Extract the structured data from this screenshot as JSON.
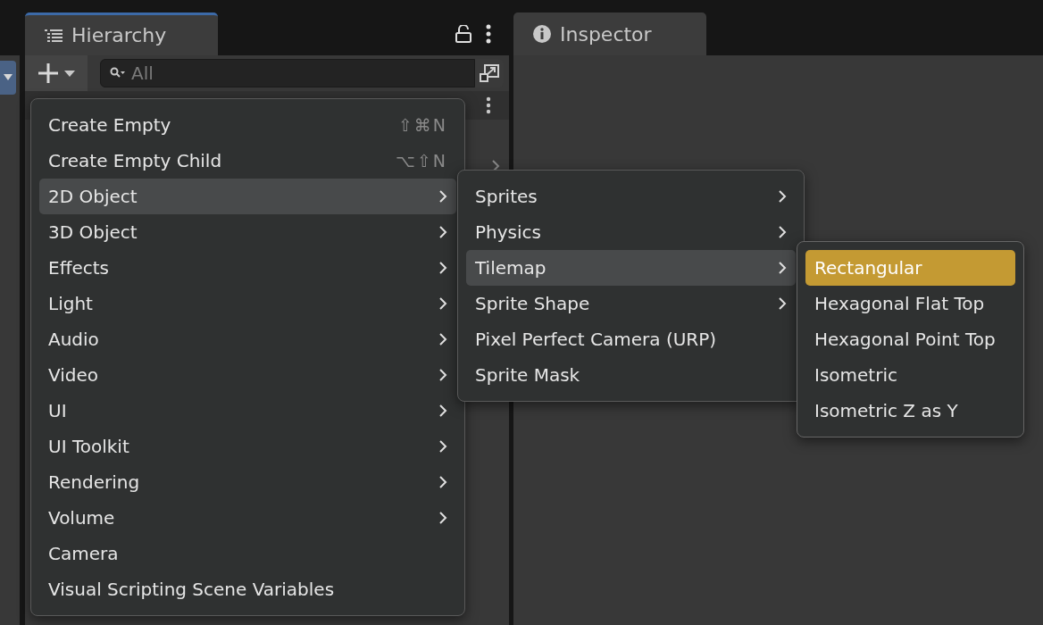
{
  "hierarchy": {
    "tab": {
      "label": "Hierarchy",
      "selected": true
    },
    "search": {
      "placeholder": "All"
    }
  },
  "inspector": {
    "tab": {
      "label": "Inspector",
      "selected": false
    }
  },
  "menus": [
    {
      "focused": false,
      "items": [
        {
          "label": "Create Empty",
          "kind": "action",
          "shortcut": "⇧⌘N",
          "selected": false
        },
        {
          "label": "Create Empty Child",
          "kind": "action",
          "shortcut": "⌥⇧N",
          "selected": false
        },
        {
          "label": "2D Object",
          "kind": "submenu",
          "selected": true
        },
        {
          "label": "3D Object",
          "kind": "submenu",
          "selected": false
        },
        {
          "label": "Effects",
          "kind": "submenu",
          "selected": false
        },
        {
          "label": "Light",
          "kind": "submenu",
          "selected": false
        },
        {
          "label": "Audio",
          "kind": "submenu",
          "selected": false
        },
        {
          "label": "Video",
          "kind": "submenu",
          "selected": false
        },
        {
          "label": "UI",
          "kind": "submenu",
          "selected": false
        },
        {
          "label": "UI Toolkit",
          "kind": "submenu",
          "selected": false
        },
        {
          "label": "Rendering",
          "kind": "submenu",
          "selected": false
        },
        {
          "label": "Volume",
          "kind": "submenu",
          "selected": false
        },
        {
          "label": "Camera",
          "kind": "action",
          "selected": false
        },
        {
          "label": "Visual Scripting Scene Variables",
          "kind": "action",
          "selected": false
        }
      ]
    },
    {
      "focused": false,
      "items": [
        {
          "label": "Sprites",
          "kind": "submenu",
          "selected": false
        },
        {
          "label": "Physics",
          "kind": "submenu",
          "selected": false
        },
        {
          "label": "Tilemap",
          "kind": "submenu",
          "selected": true
        },
        {
          "label": "Sprite Shape",
          "kind": "submenu",
          "selected": false
        },
        {
          "label": "Pixel Perfect Camera (URP)",
          "kind": "action",
          "selected": false
        },
        {
          "label": "Sprite Mask",
          "kind": "action",
          "selected": false
        }
      ]
    },
    {
      "focused": true,
      "items": [
        {
          "label": "Rectangular",
          "kind": "action",
          "selected": true
        },
        {
          "label": "Hexagonal Flat Top",
          "kind": "action",
          "selected": false
        },
        {
          "label": "Hexagonal Point Top",
          "kind": "action",
          "selected": false
        },
        {
          "label": "Isometric",
          "kind": "action",
          "selected": false
        },
        {
          "label": "Isometric Z as Y",
          "kind": "action",
          "selected": false
        }
      ]
    }
  ]
}
